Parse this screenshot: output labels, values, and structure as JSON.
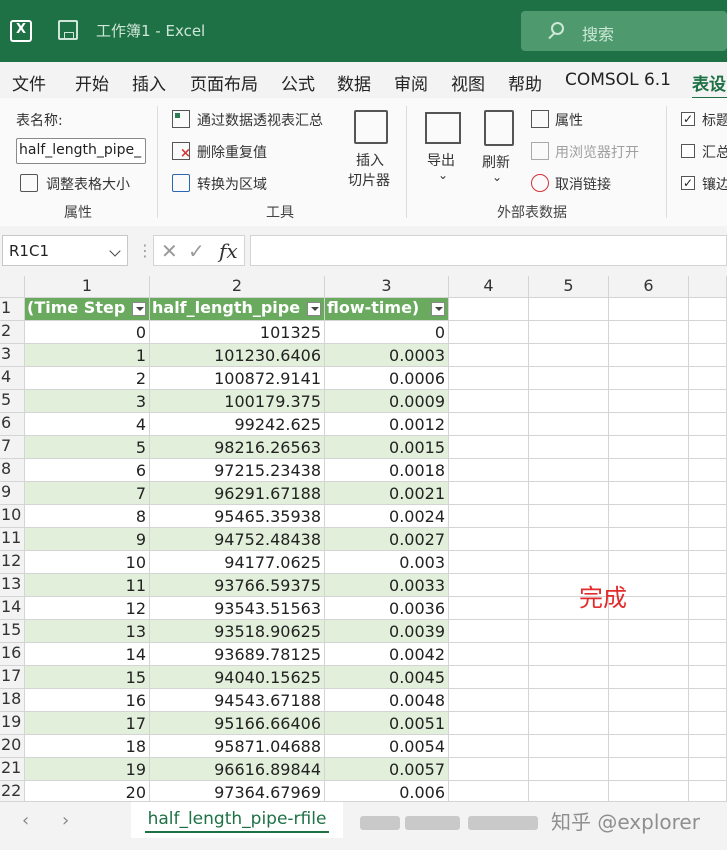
{
  "app": {
    "title": "工作簿1  -  Excel",
    "search_placeholder": "搜索"
  },
  "menu": [
    "文件",
    "开始",
    "插入",
    "页面布局",
    "公式",
    "数据",
    "审阅",
    "视图",
    "帮助",
    "COMSOL 6.1",
    "表设"
  ],
  "ribbon": {
    "table_name_label": "表名称:",
    "table_name_value": "half_length_pipe_",
    "resize_table": "调整表格大小",
    "group_properties": "属性",
    "pivot_summary": "通过数据透视表汇总",
    "remove_duplicates": "删除重复值",
    "convert_to_range": "转换为区域",
    "group_tools": "工具",
    "insert_slicer": [
      "插入",
      "切片器"
    ],
    "export": "导出",
    "refresh": "刷新",
    "properties": "属性",
    "open_in_browser": "用浏览器打开",
    "unlink": "取消链接",
    "group_external": "外部表数据",
    "opt_header_row": "标题",
    "opt_total_row": "汇总",
    "opt_banded_rows": "镶边"
  },
  "formula_bar": {
    "name_box": "R1C1",
    "fx": "fx",
    "value": ""
  },
  "grid": {
    "column_headers": [
      "1",
      "2",
      "3",
      "4",
      "5",
      "6"
    ],
    "table_headers": [
      "(Time Step",
      "half_length_pipe",
      "flow-time)"
    ],
    "rows": [
      {
        "n": "2",
        "a": "0",
        "b": "101325",
        "c": "0"
      },
      {
        "n": "3",
        "a": "1",
        "b": "101230.6406",
        "c": "0.0003"
      },
      {
        "n": "4",
        "a": "2",
        "b": "100872.9141",
        "c": "0.0006"
      },
      {
        "n": "5",
        "a": "3",
        "b": "100179.375",
        "c": "0.0009"
      },
      {
        "n": "6",
        "a": "4",
        "b": "99242.625",
        "c": "0.0012"
      },
      {
        "n": "7",
        "a": "5",
        "b": "98216.26563",
        "c": "0.0015"
      },
      {
        "n": "8",
        "a": "6",
        "b": "97215.23438",
        "c": "0.0018"
      },
      {
        "n": "9",
        "a": "7",
        "b": "96291.67188",
        "c": "0.0021"
      },
      {
        "n": "10",
        "a": "8",
        "b": "95465.35938",
        "c": "0.0024"
      },
      {
        "n": "11",
        "a": "9",
        "b": "94752.48438",
        "c": "0.0027"
      },
      {
        "n": "12",
        "a": "10",
        "b": "94177.0625",
        "c": "0.003"
      },
      {
        "n": "13",
        "a": "11",
        "b": "93766.59375",
        "c": "0.0033"
      },
      {
        "n": "14",
        "a": "12",
        "b": "93543.51563",
        "c": "0.0036"
      },
      {
        "n": "15",
        "a": "13",
        "b": "93518.90625",
        "c": "0.0039"
      },
      {
        "n": "16",
        "a": "14",
        "b": "93689.78125",
        "c": "0.0042"
      },
      {
        "n": "17",
        "a": "15",
        "b": "94040.15625",
        "c": "0.0045"
      },
      {
        "n": "18",
        "a": "16",
        "b": "94543.67188",
        "c": "0.0048"
      },
      {
        "n": "19",
        "a": "17",
        "b": "95166.66406",
        "c": "0.0051"
      },
      {
        "n": "20",
        "a": "18",
        "b": "95871.04688",
        "c": "0.0054"
      },
      {
        "n": "21",
        "a": "19",
        "b": "96616.89844",
        "c": "0.0057"
      },
      {
        "n": "22",
        "a": "20",
        "b": "97364.67969",
        "c": "0.006"
      }
    ],
    "annotation": "完成",
    "annotation_color": "#e32b2b"
  },
  "sheet_tabs": {
    "active": "half_length_pipe-rfile",
    "prev": "‹",
    "next": "›"
  },
  "watermark": "知乎 @explorer",
  "colors": {
    "brand": "#1e7145",
    "table_header": "#6aaa5f",
    "band": "#e2efda"
  }
}
